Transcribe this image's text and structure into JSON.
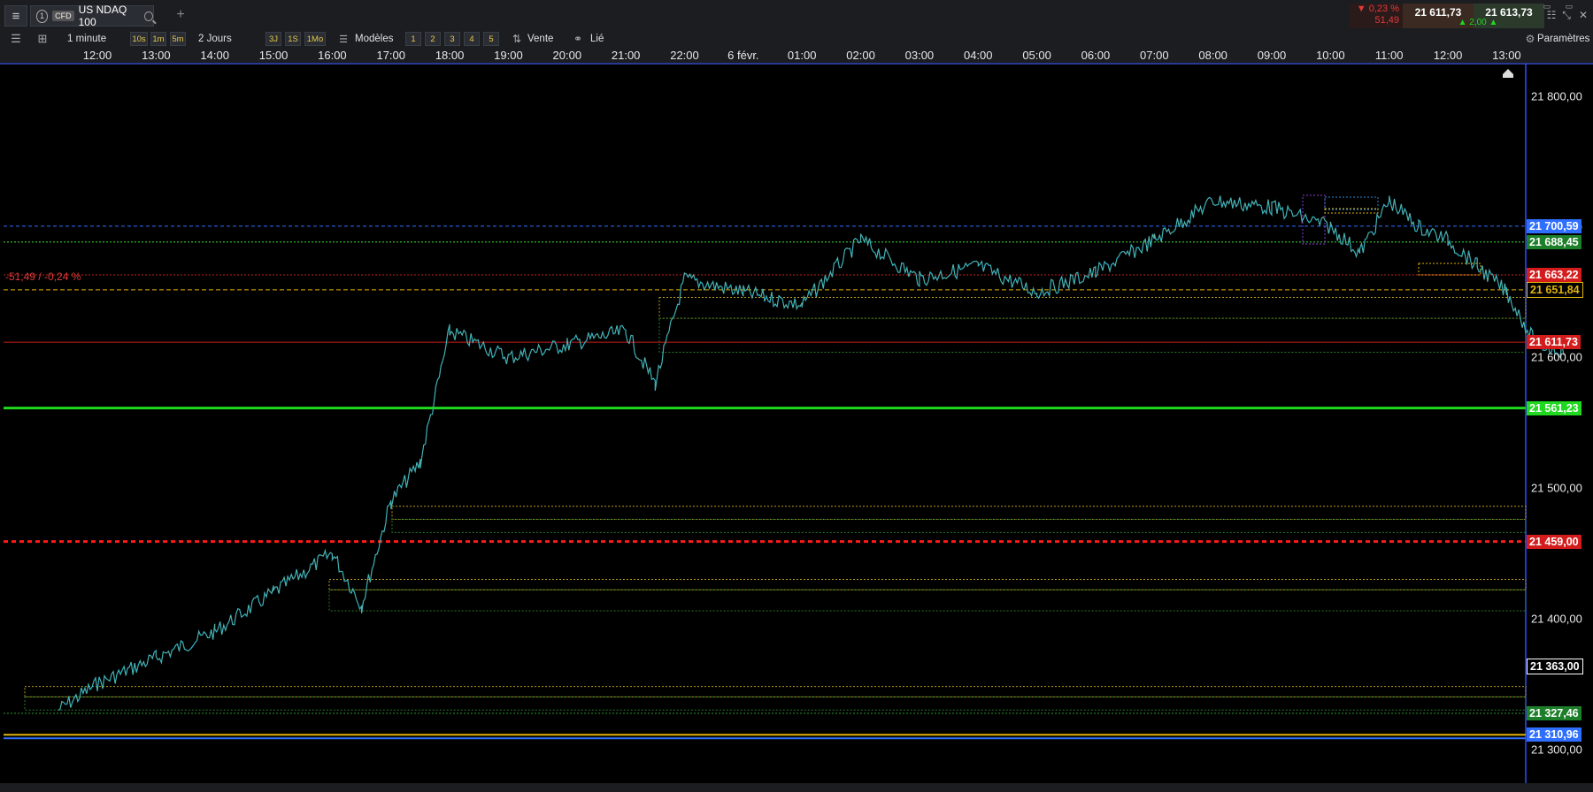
{
  "header": {
    "tab_index": "1",
    "tab_badge": "CFD",
    "symbol": "US NDAQ 100",
    "change_pct": "▼ 0,23 %",
    "change_abs": "51,49",
    "bid": "21 611,73",
    "ask": "21 613,73",
    "spread": "▲ 2,00 ▲"
  },
  "toolbar": {
    "timeframe": "1 minute",
    "periods": [
      "10s",
      "1m",
      "5m"
    ],
    "duration": "2 Jours",
    "duration_presets": [
      "3J",
      "1S",
      "1Mo"
    ],
    "models_label": "Modèles",
    "model_slots": [
      "1",
      "2",
      "3",
      "4",
      "5"
    ],
    "order_label": "Vente",
    "link_label": "Lié",
    "settings_label": "Paramètres"
  },
  "time_axis": [
    "12:00",
    "13:00",
    "14:00",
    "15:00",
    "16:00",
    "17:00",
    "18:00",
    "19:00",
    "20:00",
    "21:00",
    "22:00",
    "6 févr.",
    "01:00",
    "02:00",
    "03:00",
    "04:00",
    "05:00",
    "06:00",
    "07:00",
    "08:00",
    "09:00",
    "10:00",
    "11:00",
    "12:00",
    "13:00"
  ],
  "price_axis": [
    "21 800,00",
    "21 700,00",
    "21 600,00",
    "21 500,00",
    "21 400,00",
    "21 300,00"
  ],
  "price_labels": [
    {
      "text": "21 700,59",
      "color": "#2f6fff",
      "value": 21700.59
    },
    {
      "text": "21 688,45",
      "color": "#1e7f2a",
      "value": 21688.45
    },
    {
      "text": "21 663,22",
      "color": "#d41c1c",
      "value": 21663.22
    },
    {
      "text": "21 651,84",
      "color": "#e0b40a",
      "value": 21651.84
    },
    {
      "text": "21 611,73",
      "color": "#d41c1c",
      "value": 21611.73
    },
    {
      "text": "21 561,23",
      "color": "#1fd81f",
      "value": 21561.23
    },
    {
      "text": "21 459,00",
      "color": "#d41c1c",
      "value": 21459.0
    },
    {
      "text": "21 363,00",
      "color": "#ffffff",
      "value": 21363.0
    },
    {
      "text": "21 327,46",
      "color": "#1e7f2a",
      "value": 21327.46
    },
    {
      "text": "21 310,96",
      "color": "#2f6fff",
      "value": 21310.96
    }
  ],
  "annotation": "-51,49 / -0,24 %",
  "chart_data": {
    "type": "line",
    "ylim": [
      21290,
      21830
    ],
    "series": [
      {
        "x": [
          "11:20",
          "12:00",
          "13:00",
          "14:00",
          "15:00",
          "16:00",
          "16:30",
          "17:00",
          "17:30",
          "18:00",
          "19:00",
          "20:00",
          "21:00",
          "21:30",
          "22:00",
          "23:00",
          "00:00",
          "01:00",
          "02:00",
          "03:00",
          "04:00",
          "05:00",
          "06:00",
          "07:00",
          "08:00",
          "09:00",
          "09:30",
          "10:00",
          "10:30",
          "11:00",
          "11:30",
          "12:00",
          "12:30",
          "13:00"
        ],
        "values": [
          21330,
          21350,
          21370,
          21390,
          21420,
          21450,
          21410,
          21490,
          21520,
          21620,
          21600,
          21610,
          21620,
          21580,
          21660,
          21650,
          21640,
          21690,
          21660,
          21670,
          21650,
          21665,
          21690,
          21720,
          21715,
          21700,
          21680,
          21720,
          21700,
          21690,
          21670,
          21650,
          21610,
          21605
        ]
      }
    ]
  }
}
